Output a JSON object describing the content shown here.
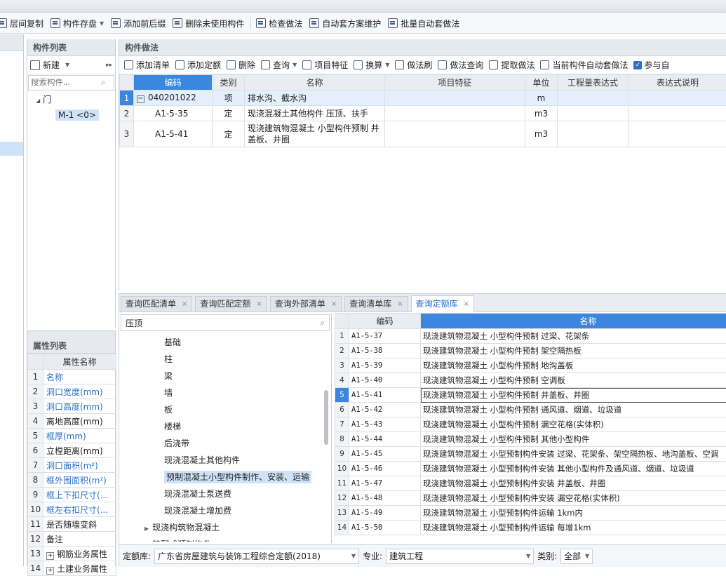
{
  "toolbar": {
    "items": [
      "层间复制",
      "构件存盘",
      "添加前后缀",
      "删除未使用构件",
      "检查做法",
      "自动套方案维护",
      "批量自动套做法"
    ]
  },
  "component_list": {
    "title": "构件列表",
    "new_label": "新建",
    "search_placeholder": "搜索构件...",
    "tree_root": "门",
    "tree_child": "M-1 <0>"
  },
  "props": {
    "title": "属性列表",
    "col_header": "属性名称",
    "rows": [
      {
        "n": "1",
        "name": "名称",
        "blue": true
      },
      {
        "n": "2",
        "name": "洞口宽度(mm)",
        "blue": true
      },
      {
        "n": "3",
        "name": "洞口高度(mm)",
        "blue": true
      },
      {
        "n": "4",
        "name": "离地高度(mm)",
        "blue": false
      },
      {
        "n": "5",
        "name": "框厚(mm)",
        "blue": true
      },
      {
        "n": "6",
        "name": "立樘距离(mm)",
        "blue": false
      },
      {
        "n": "7",
        "name": "洞口面积(m²)",
        "blue": true
      },
      {
        "n": "8",
        "name": "框外围面积(m²)",
        "blue": true
      },
      {
        "n": "9",
        "name": "框上下扣尺寸(...",
        "blue": true
      },
      {
        "n": "10",
        "name": "框左右扣尺寸(...",
        "blue": true
      },
      {
        "n": "11",
        "name": "是否随墙变斜",
        "blue": false
      },
      {
        "n": "12",
        "name": "备注",
        "blue": false
      },
      {
        "n": "13",
        "name": "钢筋业务属性",
        "blue": false,
        "plus": true
      },
      {
        "n": "14",
        "name": "土建业务属性",
        "blue": false,
        "plus": true
      }
    ]
  },
  "method": {
    "title": "构件做法",
    "toolbar": [
      "添加清单",
      "添加定额",
      "删除",
      "查询",
      "项目特征",
      "换算",
      "做法刷",
      "做法查询",
      "提取做法",
      "当前构件自动套做法",
      "参与自"
    ],
    "headers": [
      "编码",
      "类别",
      "名称",
      "项目特征",
      "单位",
      "工程量表达式",
      "表达式说明"
    ],
    "rows": [
      {
        "n": "1",
        "code": "040201022",
        "type": "项",
        "name": "排水沟、截水沟",
        "unit": "m"
      },
      {
        "n": "2",
        "code": "A1-5-35",
        "type": "定",
        "name": "现浇混凝土其他构件 压顶、扶手",
        "unit": "m3"
      },
      {
        "n": "3",
        "code": "A1-5-41",
        "type": "定",
        "name": "现浇建筑物混凝土 小型构件预制 井盖板、井圈",
        "unit": "m3"
      }
    ]
  },
  "query_tabs": [
    "查询匹配清单",
    "查询匹配定额",
    "查询外部清单",
    "查询清单库",
    "查询定额库"
  ],
  "query": {
    "search_value": "压顶",
    "tree": [
      "基础",
      "柱",
      "梁",
      "墙",
      "板",
      "楼梯",
      "后浇带",
      "现浇混凝土其他构件",
      "预制混凝土小型构件制作、安装、运输",
      "现浇混凝土泵送费",
      "现浇混凝土增加费",
      "现浇构筑物混凝土",
      "装配式预制构件"
    ],
    "headers": [
      "编码",
      "名称"
    ],
    "rows": [
      {
        "n": "1",
        "code": "A1-5-37",
        "name": "现浇建筑物混凝土 小型构件预制 过梁、花架条"
      },
      {
        "n": "2",
        "code": "A1-5-38",
        "name": "现浇建筑物混凝土 小型构件预制 架空隔热板"
      },
      {
        "n": "3",
        "code": "A1-5-39",
        "name": "现浇建筑物混凝土 小型构件预制 地沟盖板"
      },
      {
        "n": "4",
        "code": "A1-5-40",
        "name": "现浇建筑物混凝土 小型构件预制 空调板"
      },
      {
        "n": "5",
        "code": "A1-5-41",
        "name": "现浇建筑物混凝土 小型构件预制 井盖板、井圈"
      },
      {
        "n": "6",
        "code": "A1-5-42",
        "name": "现浇建筑物混凝土 小型构件预制 通风道、烟道、垃圾道"
      },
      {
        "n": "7",
        "code": "A1-5-43",
        "name": "现浇建筑物混凝土 小型构件预制 漏空花格(实体积)"
      },
      {
        "n": "8",
        "code": "A1-5-44",
        "name": "现浇建筑物混凝土 小型构件预制 其他小型构件"
      },
      {
        "n": "9",
        "code": "A1-5-45",
        "name": "现浇建筑物混凝土 小型预制构件安装 过梁、花架条、架空隔热板、地沟盖板、空调"
      },
      {
        "n": "10",
        "code": "A1-5-46",
        "name": "现浇建筑物混凝土 小型预制构件安装 其他小型构件及通风道、烟道、垃圾道"
      },
      {
        "n": "11",
        "code": "A1-5-47",
        "name": "现浇建筑物混凝土 小型预制构件安装 井盖板、井圈"
      },
      {
        "n": "12",
        "code": "A1-5-48",
        "name": "现浇建筑物混凝土 小型预制构件安装 漏空花格(实体积)"
      },
      {
        "n": "13",
        "code": "A1-5-49",
        "name": "现浇建筑物混凝土 小型预制构件运输 1km内"
      },
      {
        "n": "14",
        "code": "A1-5-50",
        "name": "现浇建筑物混凝土 小型预制构件运输 每增1km"
      }
    ]
  },
  "footer": {
    "lib_label": "定额库:",
    "lib_value": "广东省房屋建筑与装饰工程综合定额(2018)",
    "major_label": "专业:",
    "major_value": "建筑工程",
    "cat_label": "类别:",
    "cat_value": "全部"
  }
}
